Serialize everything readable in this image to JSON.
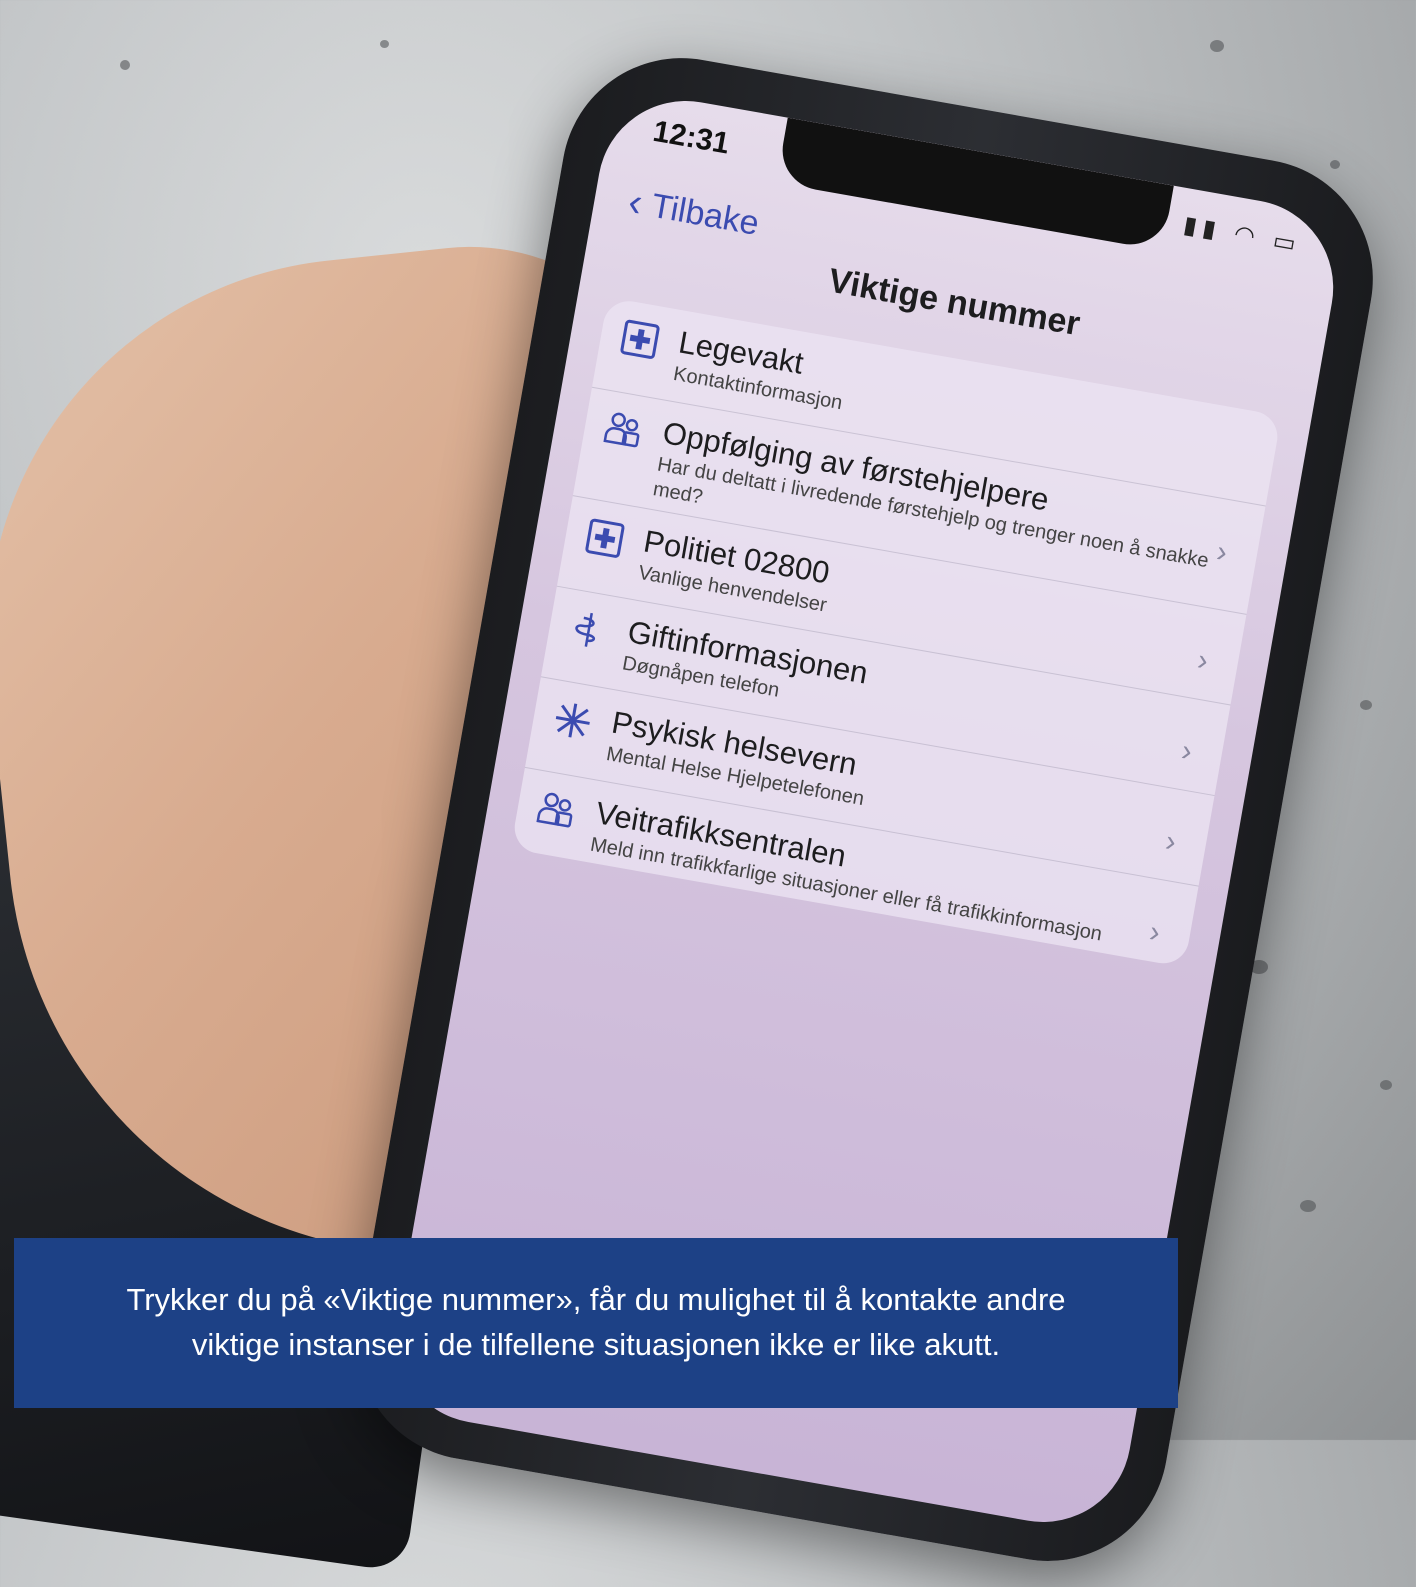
{
  "status": {
    "time": "12:31"
  },
  "nav": {
    "back_label": "Tilbake",
    "title": "Viktige nummer"
  },
  "items": [
    {
      "title": "Legevakt",
      "subtitle": "Kontaktinformasjon",
      "icon": "plus-square-icon",
      "chevron": false
    },
    {
      "title": "Oppfølging av førstehjelpere",
      "subtitle": "Har du deltatt i livredende førstehjelp og trenger noen å snakke med?",
      "icon": "people-icon",
      "chevron": true
    },
    {
      "title": "Politiet 02800",
      "subtitle": "Vanlige henvendelser",
      "icon": "plus-square-icon",
      "chevron": true
    },
    {
      "title": "Giftinformasjonen",
      "subtitle": "Døgnåpen telefon",
      "icon": "snake-staff-icon",
      "chevron": true
    },
    {
      "title": "Psykisk helsevern",
      "subtitle": "Mental Helse Hjelpetelefonen",
      "icon": "star-burst-icon",
      "chevron": true
    },
    {
      "title": "Veitrafikksentralen",
      "subtitle": "Meld inn trafikkfarlige situasjoner eller få trafikkinformasjon",
      "icon": "people-icon",
      "chevron": true
    }
  ],
  "caption": {
    "line1": "Trykker du på «Viktige nummer», får du mulighet til å kontakte andre",
    "line2": "viktige instanser i de tilfellene situasjonen ikke er like akutt."
  },
  "colors": {
    "accent": "#3b4bb0",
    "caption_bg": "#1d4186"
  }
}
